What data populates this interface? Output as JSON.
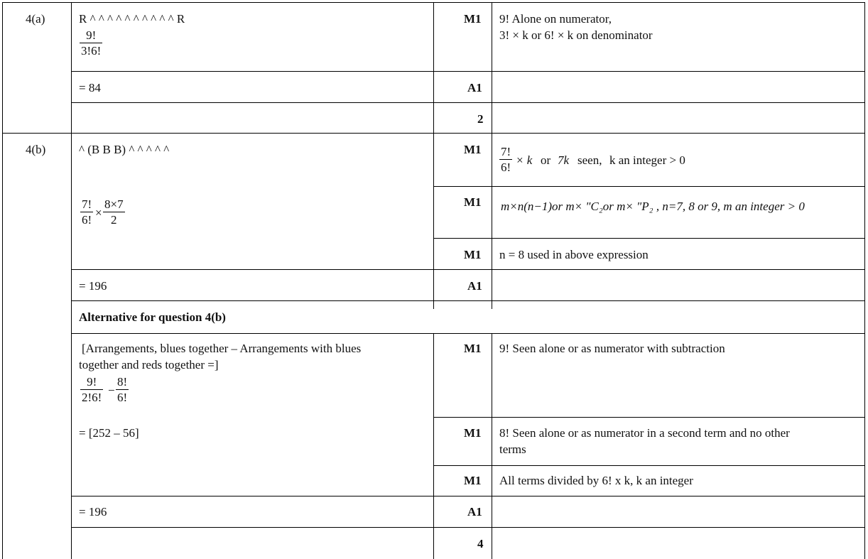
{
  "q4a": {
    "label": "4(a)",
    "arrangement": "R ^ ^ ^ ^ ^ ^ ^ ^ ^ ^ R",
    "frac_num": "9!",
    "frac_den": "3!6!",
    "m1": "M1",
    "m1_note_line1": "9! Alone on numerator,",
    "m1_note_line2": "3! × k or 6! × k on denominator",
    "result": "= 84",
    "a1": "A1",
    "total": "2"
  },
  "q4b": {
    "label": "4(b)",
    "arrangement": "^ (B B B) ^ ^ ^ ^ ^",
    "m1a": "M1",
    "m1a_frac_num": "7!",
    "m1a_frac_den": "6!",
    "m1a_note_a": "× k",
    "m1a_note_b": "or",
    "m1a_note_c": "7k",
    "m1a_note_d": "seen,",
    "m1a_note_e": "k an integer > 0",
    "work_frac1_num": "7!",
    "work_frac1_den": "6!",
    "work_times": "×",
    "work_frac2_num": "8×7",
    "work_frac2_den": "2",
    "m1b": "M1",
    "m1b_note": "m×n(n−1)or m× \"C₂or m× \"P₂ , n=7, 8 or 9, m an integer > 0",
    "m1c": "M1",
    "m1c_note": "n = 8 used in above expression",
    "result": "= 196",
    "a1": "A1"
  },
  "alt": {
    "heading": "Alternative for question 4(b)",
    "text_line1": "[Arrangements, blues together – Arrangements with blues",
    "text_line2": "together and reds together =]",
    "frac1_num": "9!",
    "frac1_den": "2!6!",
    "minus": "−",
    "frac2_num": "8!",
    "frac2_den": "6!",
    "m1a": "M1",
    "m1a_note": "9! Seen alone or as numerator with subtraction",
    "step": "= [252 – 56]",
    "m1b": "M1",
    "m1b_note_line1": "8! Seen alone or as numerator in a second term and no other",
    "m1b_note_line2": "terms",
    "m1c": "M1",
    "m1c_note": "All terms divided by 6! x k, k an integer",
    "result": "= 196",
    "a1": "A1",
    "total": "4"
  }
}
